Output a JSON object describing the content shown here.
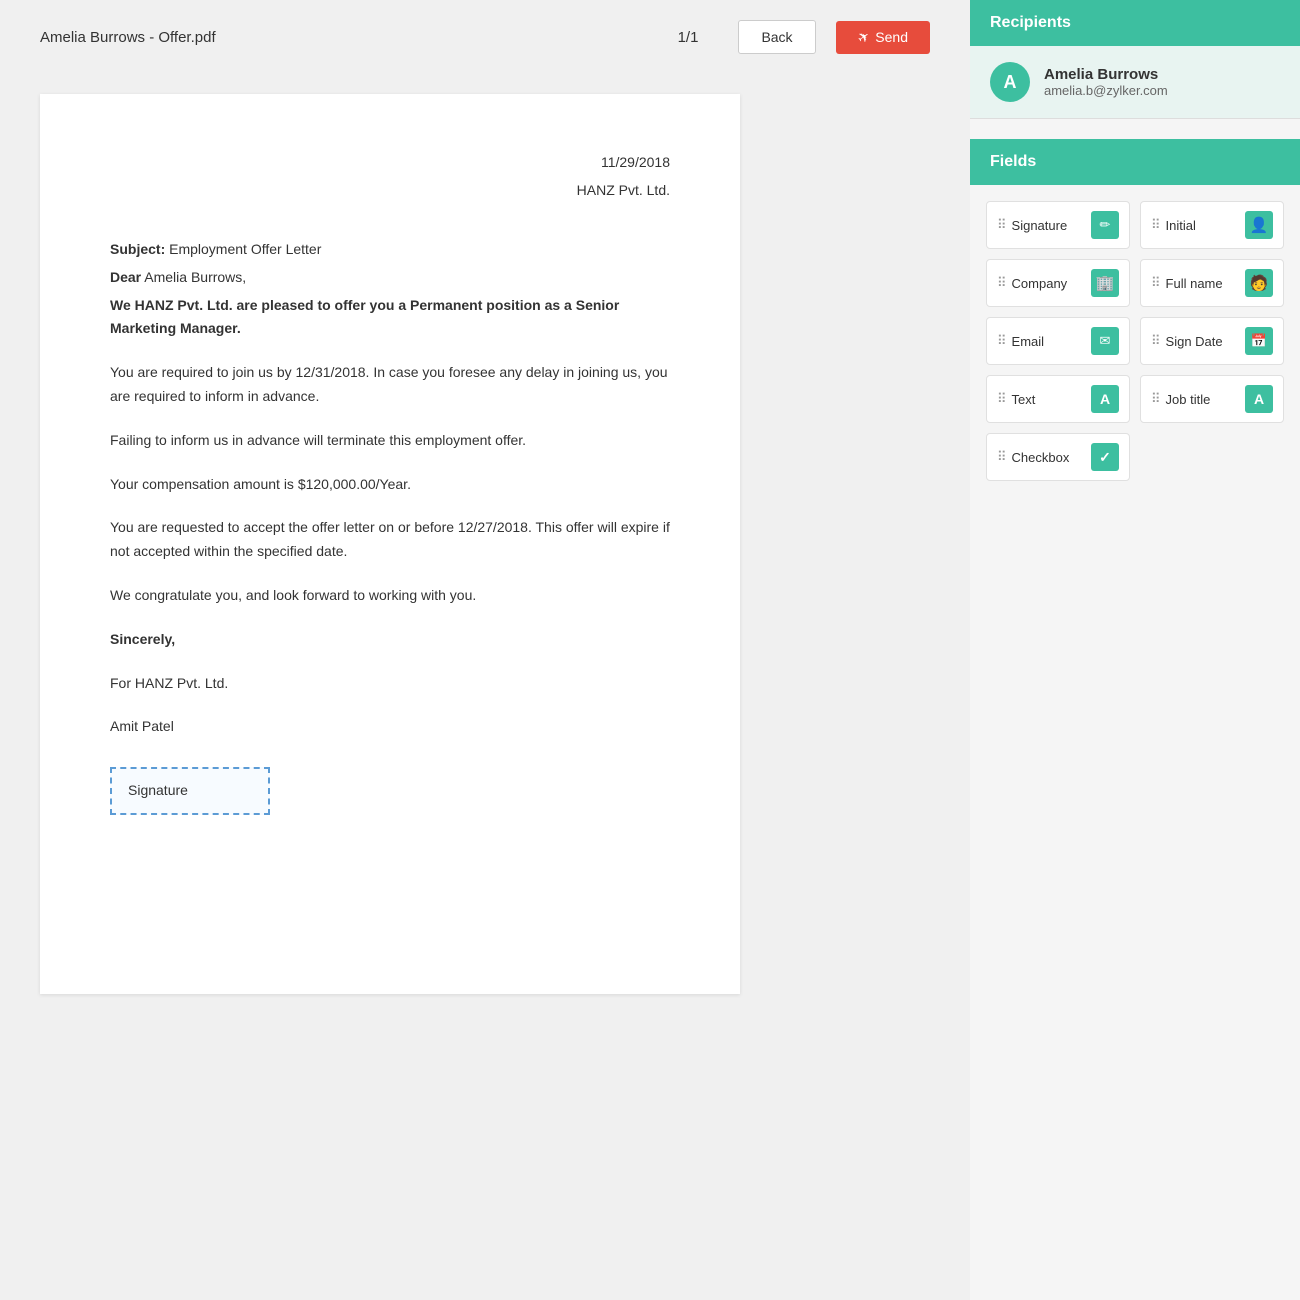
{
  "toolbar": {
    "filename": "Amelia Burrows - Offer.pdf",
    "page": "1/1",
    "back_label": "Back",
    "send_label": "Send",
    "send_icon": "✈"
  },
  "document": {
    "date": "11/29/2018",
    "company": "HANZ Pvt. Ltd.",
    "subject_prefix": "Subject:",
    "subject_text": " Employment Offer Letter",
    "dear_prefix": "Dear",
    "dear_text": " Amelia Burrows,",
    "para1": "We HANZ Pvt. Ltd. are pleased to offer you a Permanent position as a Senior Marketing Manager.",
    "para2": "You are required to join us by 12/31/2018. In case you foresee any delay in joining us, you are required to inform in advance.",
    "para3": "Failing to inform us in advance will terminate this employment offer.",
    "para4": "Your compensation amount is $120,000.00/Year.",
    "para5": "You are requested to accept the offer letter on or before 12/27/2018. This offer will expire if not accepted within the specified date.",
    "para6": "We congratulate you, and look forward to working with you.",
    "sincerely": "Sincerely,",
    "for_company": "For HANZ Pvt. Ltd.",
    "signatory": "Amit Patel",
    "signature_label": "Signature"
  },
  "sidebar": {
    "recipients_header": "Recipients",
    "recipient": {
      "initial": "A",
      "name": "Amelia Burrows",
      "email": "amelia.b@zylker.com"
    },
    "fields_header": "Fields",
    "fields": [
      {
        "id": "signature",
        "label": "Signature",
        "icon": "✏"
      },
      {
        "id": "initial",
        "label": "Initial",
        "icon": "👤"
      },
      {
        "id": "company",
        "label": "Company",
        "icon": "🏢"
      },
      {
        "id": "full_name",
        "label": "Full name",
        "icon": "🧑"
      },
      {
        "id": "email",
        "label": "Email",
        "icon": "✉"
      },
      {
        "id": "sign_date",
        "label": "Sign Date",
        "icon": "📅"
      },
      {
        "id": "text",
        "label": "Text",
        "icon": "A"
      },
      {
        "id": "job_title",
        "label": "Job title",
        "icon": "A"
      },
      {
        "id": "checkbox",
        "label": "Checkbox",
        "icon": "✓"
      }
    ]
  }
}
